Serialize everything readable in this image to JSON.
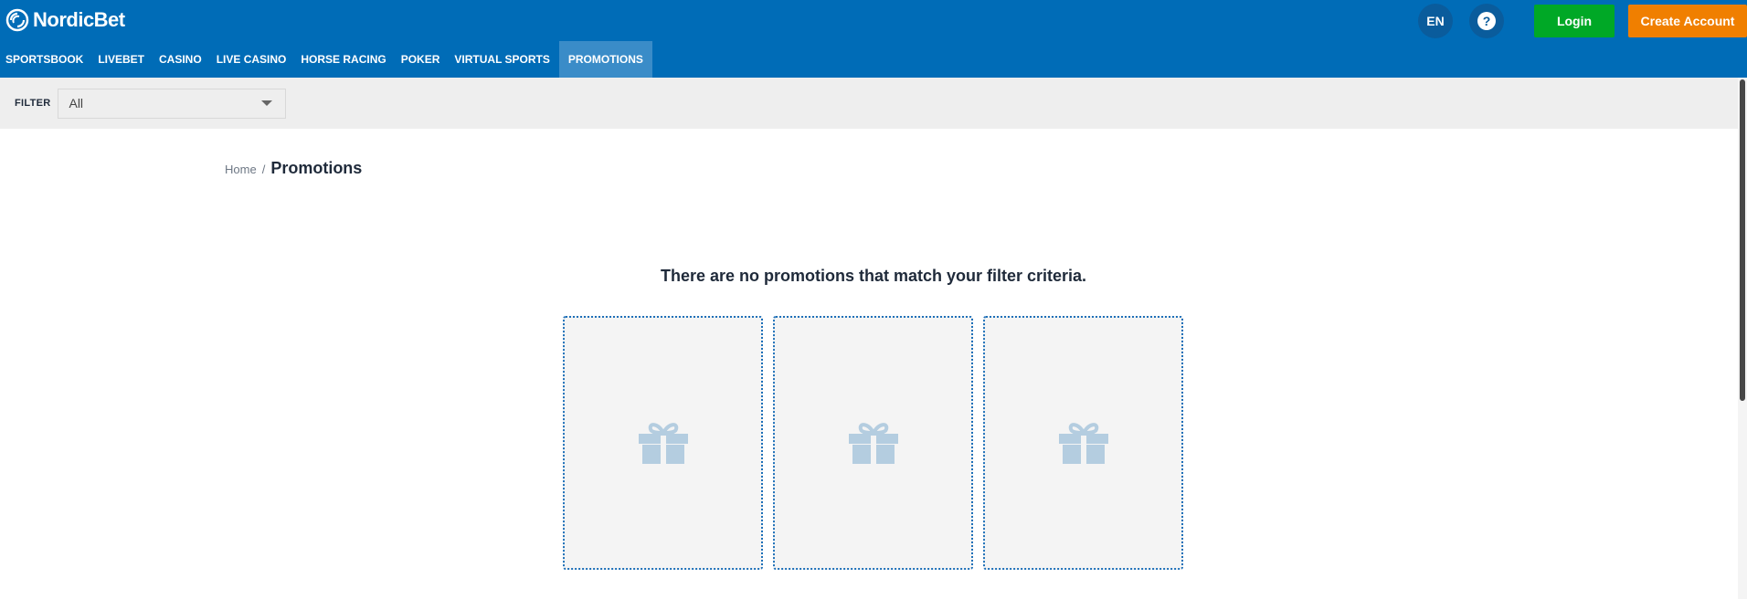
{
  "header": {
    "brand": "NordicBet",
    "language": "EN",
    "help_icon": "question-icon",
    "login_label": "Login",
    "create_account_label": "Create Account",
    "colors": {
      "header_bg": "#006cb7",
      "login_bg": "#00a826",
      "create_bg": "#f07f00",
      "active_tab_bg": "#3a8cc8"
    }
  },
  "nav": {
    "items": [
      {
        "label": "SPORTSBOOK"
      },
      {
        "label": "LIVEBET"
      },
      {
        "label": "CASINO"
      },
      {
        "label": "LIVE CASINO"
      },
      {
        "label": "HORSE RACING"
      },
      {
        "label": "POKER"
      },
      {
        "label": "VIRTUAL SPORTS"
      },
      {
        "label": "PROMOTIONS",
        "active": true
      }
    ]
  },
  "filter": {
    "label": "FILTER",
    "selected": "All"
  },
  "breadcrumb": {
    "home": "Home",
    "separator": "/",
    "current": "Promotions"
  },
  "main": {
    "empty_message": "There are no promotions that match your filter criteria.",
    "placeholder_cards": [
      {
        "icon": "gift-icon"
      },
      {
        "icon": "gift-icon"
      },
      {
        "icon": "gift-icon"
      }
    ]
  }
}
